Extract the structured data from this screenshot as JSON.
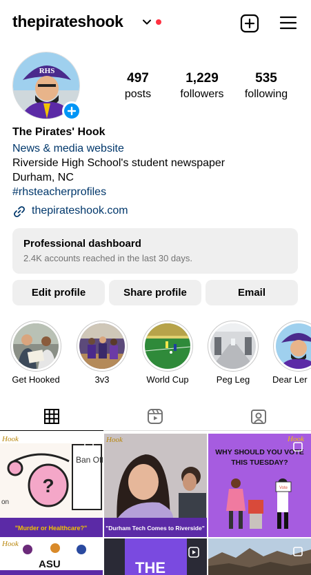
{
  "header": {
    "username": "thepirateshook"
  },
  "profile": {
    "stats": [
      {
        "value": "497",
        "label": "posts"
      },
      {
        "value": "1,229",
        "label": "followers"
      },
      {
        "value": "535",
        "label": "following"
      }
    ],
    "name": "The Pirates' Hook",
    "category": "News & media website",
    "bio_lines": [
      "Riverside High School's student newspaper",
      "Durham, NC"
    ],
    "hashtag": "#rhsteacherprofiles",
    "link": "thepirateshook.com",
    "avatar_text": "RHS"
  },
  "dashboard": {
    "title": "Professional dashboard",
    "subtitle": "2.4K accounts reached in the last 30 days."
  },
  "buttons": {
    "edit": "Edit profile",
    "share": "Share profile",
    "email": "Email"
  },
  "highlights": [
    {
      "label": "Get Hooked"
    },
    {
      "label": "3v3"
    },
    {
      "label": "World Cup"
    },
    {
      "label": "Peg Leg"
    },
    {
      "label": "Dear Ler"
    }
  ],
  "posts": {
    "p1": {
      "logo": "Hook",
      "caption": "\"Murder or Healthcare?\"",
      "side_text": "Ban Off My Body",
      "edge_text": "on"
    },
    "p2": {
      "logo": "Hook",
      "caption": "\"Durham Tech Comes to Riverside\""
    },
    "p3": {
      "logo": "Hook",
      "headline": "WHY SHOULD YOU VOTE THIS TUESDAY?",
      "sign": "Vote"
    },
    "p4": {
      "logo": "Hook",
      "text": "ASU"
    },
    "p5": {
      "text": "THE"
    }
  },
  "colors": {
    "link": "#00376b",
    "accent": "#0095f6",
    "notify": "#ff3040",
    "purple": "#5b2aa6",
    "gold": "#f2c400"
  }
}
